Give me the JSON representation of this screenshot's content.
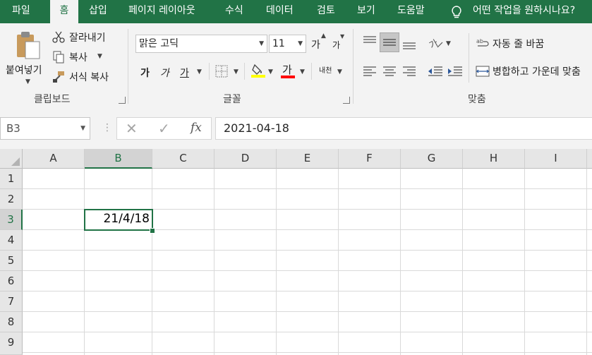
{
  "tabs": [
    "파일",
    "홈",
    "삽입",
    "페이지 레이아웃",
    "수식",
    "데이터",
    "검토",
    "보기",
    "도움말"
  ],
  "tell_me": "어떤 작업을 원하시나요?",
  "clipboard": {
    "paste": "붙여넣기",
    "cut": "잘라내기",
    "copy": "복사",
    "format_painter": "서식 복사",
    "group": "클립보드"
  },
  "font": {
    "name": "맑은 고딕",
    "size": "11",
    "grow": "가",
    "shrink": "가",
    "bold": "가",
    "italic": "가",
    "underline": "가",
    "font_color": "가",
    "phonetic": "내천",
    "group": "글꼴"
  },
  "alignment": {
    "wrap_text": "자동 줄 바꿈",
    "merge_center": "병합하고 가운데 맞춤",
    "group": "맞춤"
  },
  "colors": {
    "accent": "#217346",
    "highlight": "#ffff00",
    "font_color": "#ff0000"
  },
  "formula_bar": {
    "name_box": "B3",
    "cancel": "✕",
    "enter": "✓",
    "fx": "fx",
    "value": "2021-04-18"
  },
  "sheet": {
    "columns": [
      "A",
      "B",
      "C",
      "D",
      "E",
      "F",
      "G",
      "H",
      "I"
    ],
    "rows": [
      "1",
      "2",
      "3",
      "4",
      "5",
      "6",
      "7",
      "8",
      "9"
    ],
    "active_cell_value": "21/4/18"
  }
}
